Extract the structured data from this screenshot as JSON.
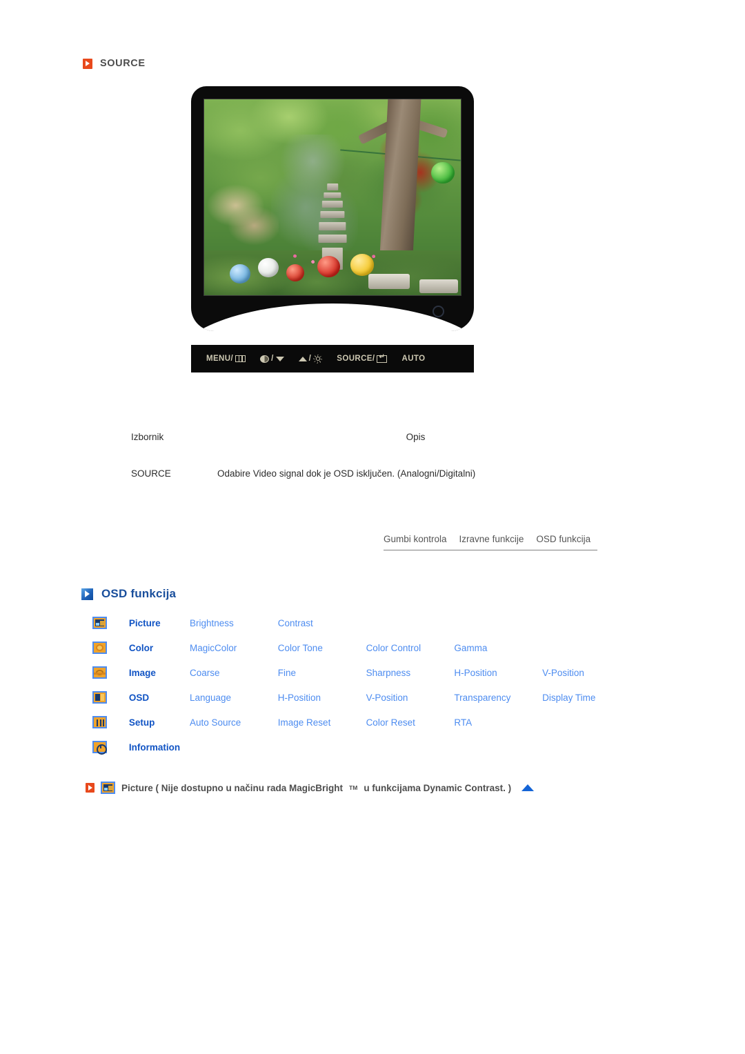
{
  "section": {
    "title": "SOURCE",
    "bullet_color": "#e8491c"
  },
  "monitor": {
    "screen_photo_alt": "korean-garden-pagoda-photo",
    "buttons": [
      {
        "name": "menu-button",
        "text": "MENU/",
        "icon": "menu-grid-icon"
      },
      {
        "name": "down-button",
        "text": "/",
        "icon_left": "magicbright-half-circle-icon",
        "icon_right": "triangle-down-icon"
      },
      {
        "name": "up-button",
        "text": "/",
        "icon_left": "triangle-up-icon",
        "icon_right": "brightness-sun-icon"
      },
      {
        "name": "source-button",
        "text": "SOURCE/",
        "icon": "enter-key-icon"
      },
      {
        "name": "auto-button",
        "text": "AUTO",
        "icon": ""
      }
    ]
  },
  "desc_table": {
    "headers": {
      "menu": "Izbornik",
      "description": "Opis"
    },
    "rows": [
      {
        "menu": "SOURCE",
        "description": "Odabire Video signal dok je OSD isključen. (Analogni/Digitalni)"
      }
    ]
  },
  "nav_tabs": [
    {
      "label": "Gumbi kontrola"
    },
    {
      "label": "Izravne funkcije"
    },
    {
      "label": "OSD funkcija"
    }
  ],
  "osd_section": {
    "title": "OSD funkcija",
    "bullet_color": "#1e62b8",
    "title_color": "#1a4f9c"
  },
  "osd_menu": {
    "rows": [
      {
        "icon": "picture-icon",
        "category": "Picture",
        "items": [
          "Brightness",
          "Contrast"
        ]
      },
      {
        "icon": "color-icon",
        "category": "Color",
        "items": [
          "MagicColor",
          "Color Tone",
          "Color Control",
          "Gamma"
        ]
      },
      {
        "icon": "image-icon",
        "category": "Image",
        "items": [
          "Coarse",
          "Fine",
          "Sharpness",
          "H-Position",
          "V-Position"
        ]
      },
      {
        "icon": "osd-icon",
        "category": "OSD",
        "items": [
          "Language",
          "H-Position",
          "V-Position",
          "Transparency",
          "Display Time"
        ]
      },
      {
        "icon": "setup-icon",
        "category": "Setup",
        "items": [
          "Auto Source",
          "Image Reset",
          "Color Reset",
          "RTA"
        ]
      },
      {
        "icon": "information-icon",
        "category": "Information",
        "items": []
      }
    ]
  },
  "footer_note": {
    "text_before": "Picture ( Nije dostupno u načinu rada MagicBright",
    "superscript": "TM",
    "text_after": " u funkcijama Dynamic Contrast. )",
    "arrow_color": "#1464d6"
  }
}
